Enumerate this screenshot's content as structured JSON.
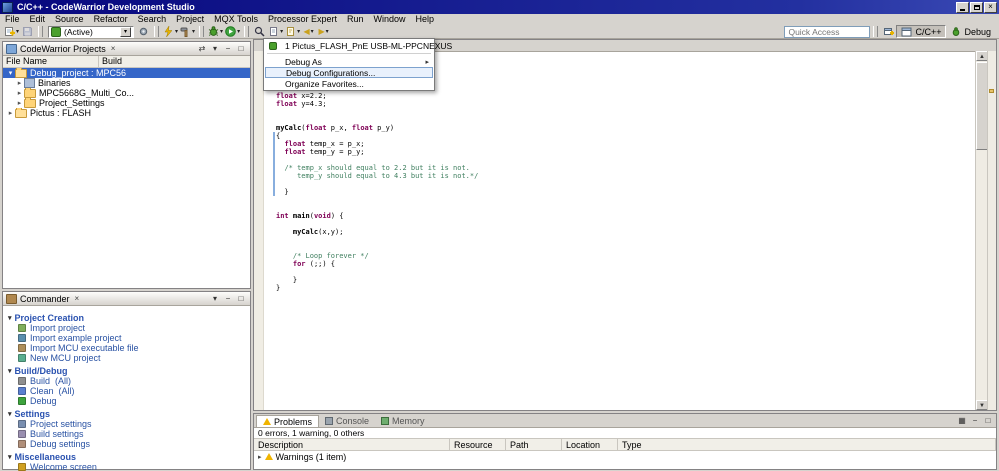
{
  "window": {
    "title": "C/C++ - CodeWarrior Development Studio"
  },
  "menubar": [
    "File",
    "Edit",
    "Source",
    "Refactor",
    "Search",
    "Project",
    "MQX Tools",
    "Processor Expert",
    "Run",
    "Window",
    "Help"
  ],
  "toolbar": {
    "active_combo": "(Active)",
    "quick_access": "Quick Access",
    "perspectives": {
      "cpp": "C/C++",
      "debug": "Debug"
    }
  },
  "debug_dropdown": {
    "items": [
      {
        "label": "1 Pictus_FLASH_PnE USB-ML-PPCNEXUS",
        "icon": "debug-launch"
      },
      {
        "separator": true
      },
      {
        "label": "Debug As",
        "submenu": true
      },
      {
        "label": "Debug Configurations...",
        "highlighted": true
      },
      {
        "label": "Organize Favorites..."
      }
    ]
  },
  "projects_panel": {
    "tab": "CodeWarrior Projects",
    "columns": [
      "File Name",
      "Build"
    ],
    "tree": [
      {
        "label": "Debug_project : MPC56",
        "depth": 0,
        "expanded": true,
        "selected": true,
        "icon": "project"
      },
      {
        "label": "Binaries",
        "depth": 1,
        "expanded": false,
        "selected": false,
        "icon": "binaries"
      },
      {
        "label": "MPC5668G_Multi_Co...",
        "depth": 1,
        "expanded": false,
        "selected": false,
        "icon": "folder"
      },
      {
        "label": "Project_Settings",
        "depth": 1,
        "expanded": false,
        "selected": false,
        "icon": "folder"
      },
      {
        "label": "Pictus : FLASH",
        "depth": 0,
        "expanded": false,
        "selected": false,
        "icon": "project"
      }
    ]
  },
  "commander": {
    "tab": "Commander",
    "sections": [
      {
        "title": "Project Creation",
        "items": [
          {
            "label": "Import project",
            "icon": "import-project"
          },
          {
            "label": "Import example project",
            "icon": "import-example"
          },
          {
            "label": "Import MCU executable file",
            "icon": "import-mcu"
          },
          {
            "label": "New MCU project",
            "icon": "new-mcu"
          }
        ]
      },
      {
        "title": "Build/Debug",
        "items": [
          {
            "label": "Build  (All)",
            "icon": "build"
          },
          {
            "label": "Clean  (All)",
            "icon": "clean"
          },
          {
            "label": "Debug",
            "icon": "debug"
          }
        ]
      },
      {
        "title": "Settings",
        "items": [
          {
            "label": "Project settings",
            "icon": "project-settings"
          },
          {
            "label": "Build settings",
            "icon": "build-settings"
          },
          {
            "label": "Debug settings",
            "icon": "debug-settings"
          }
        ]
      },
      {
        "title": "Miscellaneous",
        "items": [
          {
            "label": "Welcome screen",
            "icon": "welcome"
          }
        ]
      }
    ]
  },
  "editor": {
    "lines": [
      {
        "t": [
          [
            "k",
            "float"
          ],
          [
            "p",
            " x=2.2;"
          ]
        ]
      },
      {
        "t": [
          [
            "k",
            "float"
          ],
          [
            "p",
            " y=4.3;"
          ]
        ]
      },
      {
        "t": []
      },
      {
        "t": []
      },
      {
        "fold": true,
        "t": [
          [
            "b",
            "myCalc"
          ],
          [
            "p",
            "("
          ],
          [
            "k",
            "float"
          ],
          [
            "p",
            " p_x, "
          ],
          [
            "k",
            "float"
          ],
          [
            "p",
            " p_y)"
          ]
        ]
      },
      {
        "t": [
          [
            "p",
            "{"
          ]
        ]
      },
      {
        "t": [
          [
            "p",
            "  "
          ],
          [
            "k",
            "float"
          ],
          [
            "p",
            " temp_x = p_x;"
          ]
        ]
      },
      {
        "t": [
          [
            "p",
            "  "
          ],
          [
            "k",
            "float"
          ],
          [
            "p",
            " temp_y = p_y;"
          ]
        ]
      },
      {
        "t": []
      },
      {
        "fold": true,
        "t": [
          [
            "p",
            "  "
          ],
          [
            "c",
            "/* temp_x should equal to 2.2 but it is not."
          ]
        ]
      },
      {
        "t": [
          [
            "p",
            "  "
          ],
          [
            "c",
            "   temp_y should equal to 4.3 but it is not.*/"
          ]
        ]
      },
      {
        "t": []
      },
      {
        "t": [
          [
            "p",
            "  }"
          ]
        ]
      },
      {
        "t": []
      },
      {
        "t": []
      },
      {
        "fold": true,
        "t": [
          [
            "k",
            "int"
          ],
          [
            "p",
            " "
          ],
          [
            "b",
            "main"
          ],
          [
            "p",
            "("
          ],
          [
            "k",
            "void"
          ],
          [
            "p",
            ") {"
          ]
        ]
      },
      {
        "t": []
      },
      {
        "t": [
          [
            "p",
            "    "
          ],
          [
            "b",
            "myCalc"
          ],
          [
            "p",
            "(x,y);"
          ]
        ]
      },
      {
        "t": []
      },
      {
        "t": []
      },
      {
        "t": [
          [
            "p",
            "    "
          ],
          [
            "c",
            "/* Loop forever */"
          ]
        ]
      },
      {
        "t": [
          [
            "p",
            "    "
          ],
          [
            "k",
            "for"
          ],
          [
            "p",
            " (;;) {"
          ]
        ]
      },
      {
        "t": []
      },
      {
        "t": [
          [
            "p",
            "    }"
          ]
        ]
      },
      {
        "t": [
          [
            "p",
            "}"
          ]
        ]
      }
    ]
  },
  "problems": {
    "tabs": [
      {
        "label": "Problems",
        "active": true,
        "icon": "problems"
      },
      {
        "label": "Console",
        "active": false,
        "icon": "console"
      },
      {
        "label": "Memory",
        "active": false,
        "icon": "memory"
      }
    ],
    "status": "0 errors, 1 warning, 0 others",
    "columns": [
      "Description",
      "Resource",
      "Path",
      "Location",
      "Type"
    ],
    "rows": [
      {
        "description": "Warnings (1 item)"
      }
    ]
  },
  "colors": {
    "titlebar": "#07077e",
    "selection": "#3566c8",
    "keyword": "#7f0055",
    "comment": "#3f7f5f",
    "warning": "#f0b400",
    "link": "#2952a3",
    "section_header": "#2a52b0"
  }
}
